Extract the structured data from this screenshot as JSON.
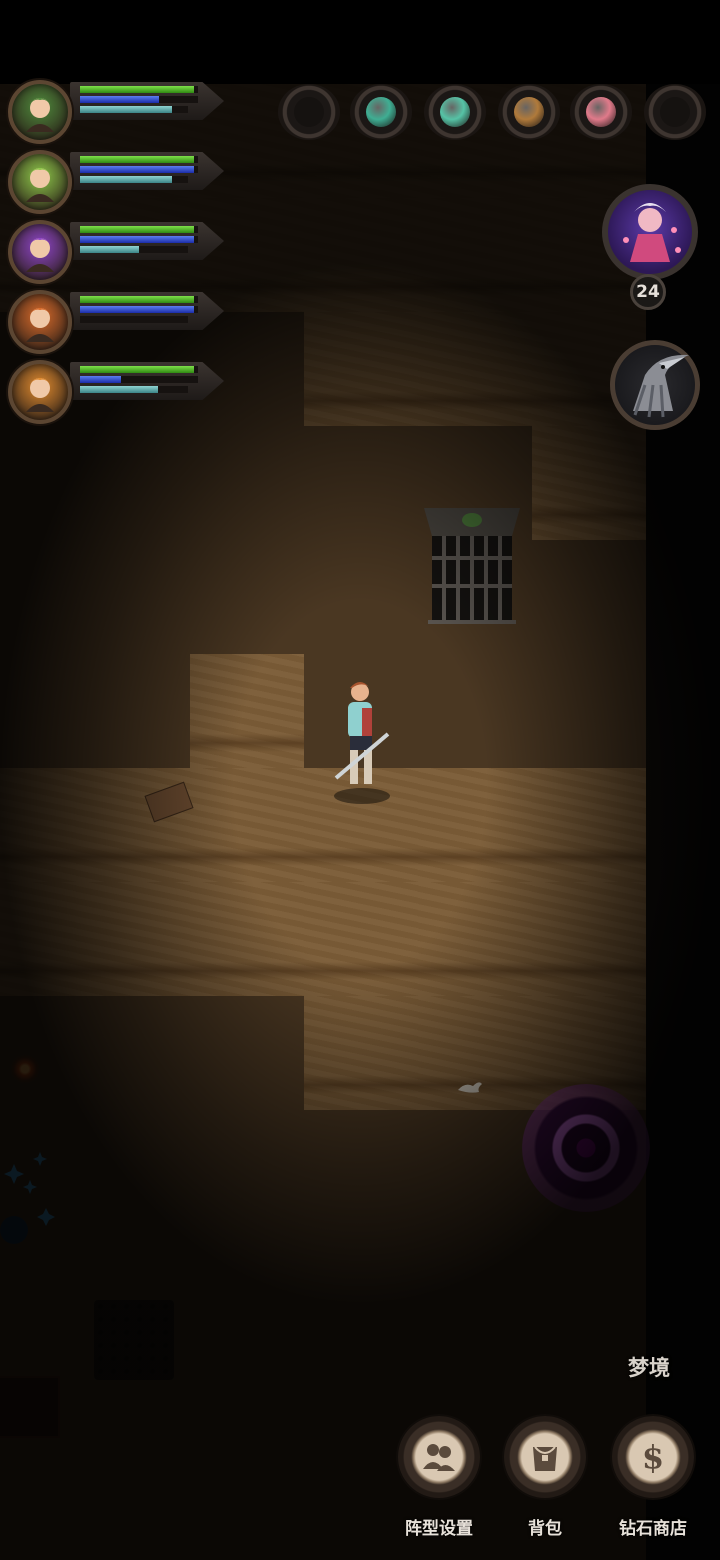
{
  "party": [
    {
      "name": "hero-1",
      "hp": 0.97,
      "mp": 0.67,
      "xp": 0.85,
      "portrait_color": "#4f8a3c"
    },
    {
      "name": "hero-2",
      "hp": 0.97,
      "mp": 0.97,
      "xp": 0.85,
      "portrait_color": "#8ec84a"
    },
    {
      "name": "hero-3",
      "hp": 0.97,
      "mp": 0.97,
      "xp": 0.55,
      "portrait_color": "#8e45c8"
    },
    {
      "name": "hero-4",
      "hp": 0.97,
      "mp": 0.97,
      "xp": 0.0,
      "portrait_color": "#d86a2a"
    },
    {
      "name": "hero-5",
      "hp": 0.97,
      "mp": 0.35,
      "xp": 0.72,
      "portrait_color": "#e08a2e"
    }
  ],
  "items": [
    {
      "icon": "empty-slot",
      "color": "#1a1614"
    },
    {
      "icon": "green-potion-icon",
      "color": "#3fae93"
    },
    {
      "icon": "swirl-orb-icon",
      "color": "#56c3a6"
    },
    {
      "icon": "rune-scroll-icon",
      "color": "#b07a3b"
    },
    {
      "icon": "eyeball-icon",
      "color": "#e07a8a"
    },
    {
      "icon": "empty-slot",
      "color": "#1a1614"
    }
  ],
  "boss": {
    "level": "24",
    "color": "#5b3aa8"
  },
  "skill": {
    "icon": "raven-skill-icon"
  },
  "menu": {
    "dream_label": "梦境",
    "buttons": [
      {
        "label": "阵型设置",
        "icon": "formation-icon"
      },
      {
        "label": "背包",
        "icon": "bag-icon"
      },
      {
        "label": "钻石商店",
        "icon": "dollar-icon"
      }
    ]
  }
}
